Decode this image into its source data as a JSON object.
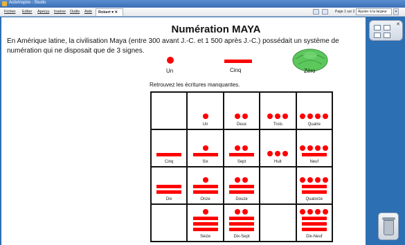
{
  "window": {
    "title": "ActivInspire - Studio"
  },
  "menu": [
    "Fichier",
    "Editer",
    "Aperçu",
    "Insérer",
    "Outils",
    "Aide"
  ],
  "tab": {
    "label": "Robert ▾ ✕"
  },
  "toolbar": {
    "page_text": "Page 1 sur 2",
    "zoom_text": "Ajuster à la largeur"
  },
  "page": {
    "heading": "Numération MAYA",
    "intro": "En Amérique latine, la civilisation Maya (entre 300 avant J.-C. et 1 500 après J.-C.) possédait un système de numération qui ne disposait que de 3 signes.",
    "legend": {
      "one": "Un",
      "five": "Cinq",
      "zero": "Zéro"
    },
    "instruction": "Retrouvez les écritures manquantes.",
    "grid": [
      [
        null,
        {
          "label": "Un",
          "dots": 1,
          "bars": 0
        },
        {
          "label": "Deux",
          "dots": 2,
          "bars": 0
        },
        {
          "label": "Trois",
          "dots": 3,
          "bars": 0
        },
        {
          "label": "Quatre",
          "dots": 4,
          "bars": 0
        }
      ],
      [
        {
          "label": "Cinq",
          "dots": 0,
          "bars": 1
        },
        {
          "label": "Six",
          "dots": 1,
          "bars": 1
        },
        {
          "label": "Sept",
          "dots": 2,
          "bars": 1
        },
        {
          "label": "Huit",
          "dots": 3,
          "bars": 0
        },
        {
          "label": "Neuf",
          "dots": 4,
          "bars": 1
        }
      ],
      [
        {
          "label": "Dix",
          "dots": 0,
          "bars": 2
        },
        {
          "label": "Onze",
          "dots": 1,
          "bars": 2
        },
        {
          "label": "Douze",
          "dots": 2,
          "bars": 2
        },
        null,
        {
          "label": "Quatorze",
          "dots": 4,
          "bars": 2
        }
      ],
      [
        null,
        {
          "label": "Seize",
          "dots": 1,
          "bars": 3
        },
        {
          "label": "Dix-Sept",
          "dots": 2,
          "bars": 3
        },
        null,
        {
          "label": "Dix-Neuf",
          "dots": 4,
          "bars": 3
        }
      ]
    ]
  },
  "colors": {
    "accent": "#ff0000",
    "shell": "#5cc85c",
    "desktop": "#2c6fb3"
  }
}
